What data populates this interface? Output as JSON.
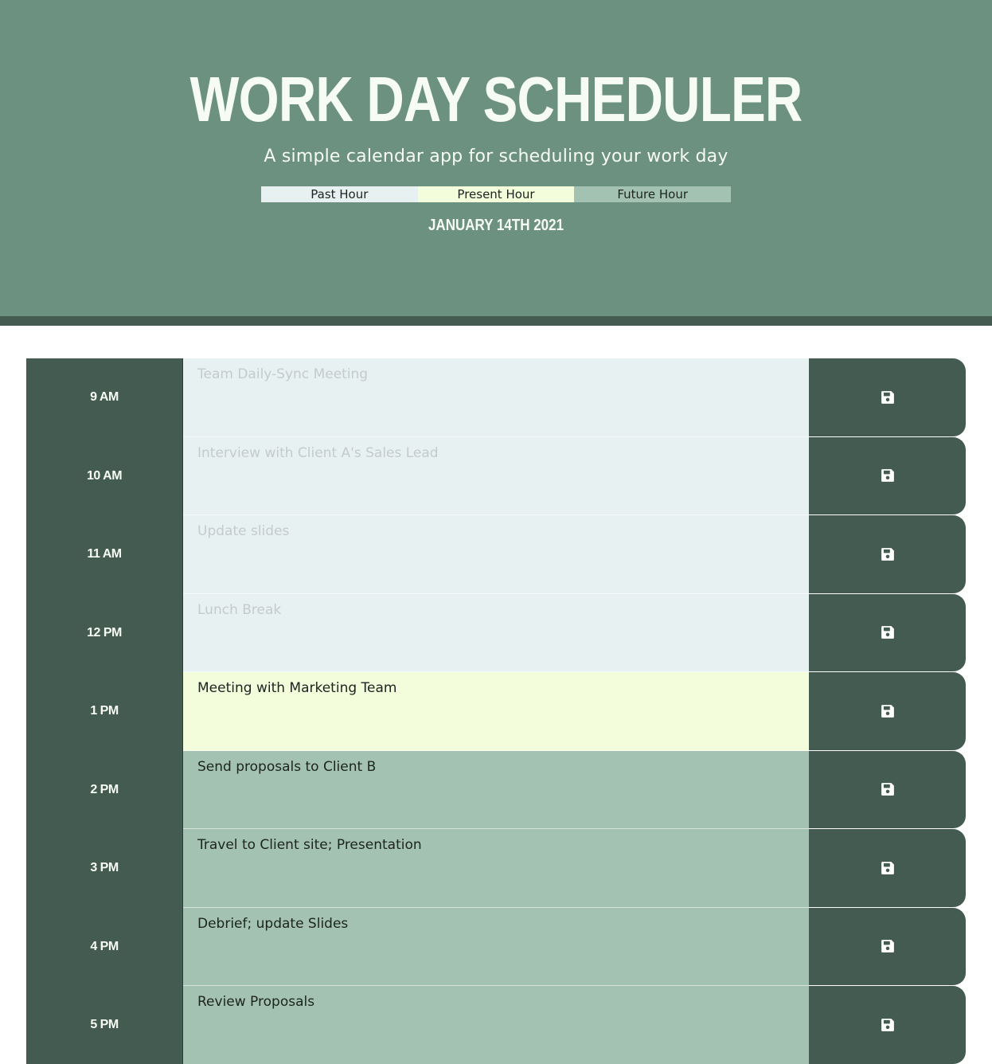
{
  "header": {
    "title": "WORK DAY SCHEDULER",
    "lead": "A simple calendar app for scheduling your work day",
    "legend": {
      "past": "Past Hour",
      "present": "Present Hour",
      "future": "Future Hour"
    },
    "current_day": "JANUARY 14TH 2021"
  },
  "colors": {
    "header_bg": "#6c9181",
    "dark": "#445b51",
    "past": "#e8f1f2",
    "present": "#f3fcdb",
    "future": "#a4c2b2"
  },
  "schedule": [
    {
      "hour": "9 AM",
      "text": "Team Daily-Sync Meeting",
      "state": "past",
      "icon": "save-icon"
    },
    {
      "hour": "10 AM",
      "text": "Interview with Client A's Sales Lead",
      "state": "past",
      "icon": "save-icon"
    },
    {
      "hour": "11 AM",
      "text": "Update slides",
      "state": "past",
      "icon": "save-icon"
    },
    {
      "hour": "12 PM",
      "text": "Lunch Break",
      "state": "past",
      "icon": "save-icon"
    },
    {
      "hour": "1 PM",
      "text": "Meeting with Marketing Team",
      "state": "present",
      "icon": "save-icon"
    },
    {
      "hour": "2 PM",
      "text": "Send proposals to Client B",
      "state": "future",
      "icon": "save-icon"
    },
    {
      "hour": "3 PM",
      "text": "Travel to Client site; Presentation",
      "state": "future",
      "icon": "save-icon"
    },
    {
      "hour": "4 PM",
      "text": "Debrief; update Slides",
      "state": "future",
      "icon": "save-icon"
    },
    {
      "hour": "5 PM",
      "text": "Review Proposals",
      "state": "future",
      "icon": "save-icon"
    }
  ]
}
